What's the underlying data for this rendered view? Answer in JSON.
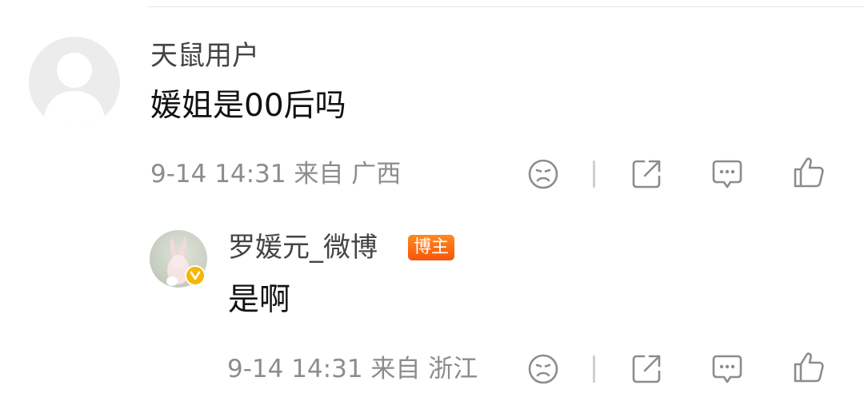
{
  "comment": {
    "username": "天鼠用户",
    "text": "媛姐是00后吗",
    "meta": "9-14 14:31 来自 广西",
    "actions": [
      "emoji-icon",
      "share-icon",
      "comment-icon",
      "like-icon"
    ]
  },
  "reply": {
    "username": "罗媛元_微博",
    "badge": "博主",
    "text": "是啊",
    "meta": "9-14 14:31 来自 浙江",
    "actions": [
      "emoji-icon",
      "share-icon",
      "comment-icon",
      "like-icon"
    ]
  },
  "colors": {
    "badge": "#f5560c",
    "verified": "#f5b800",
    "meta_text": "#8c8c8c"
  }
}
